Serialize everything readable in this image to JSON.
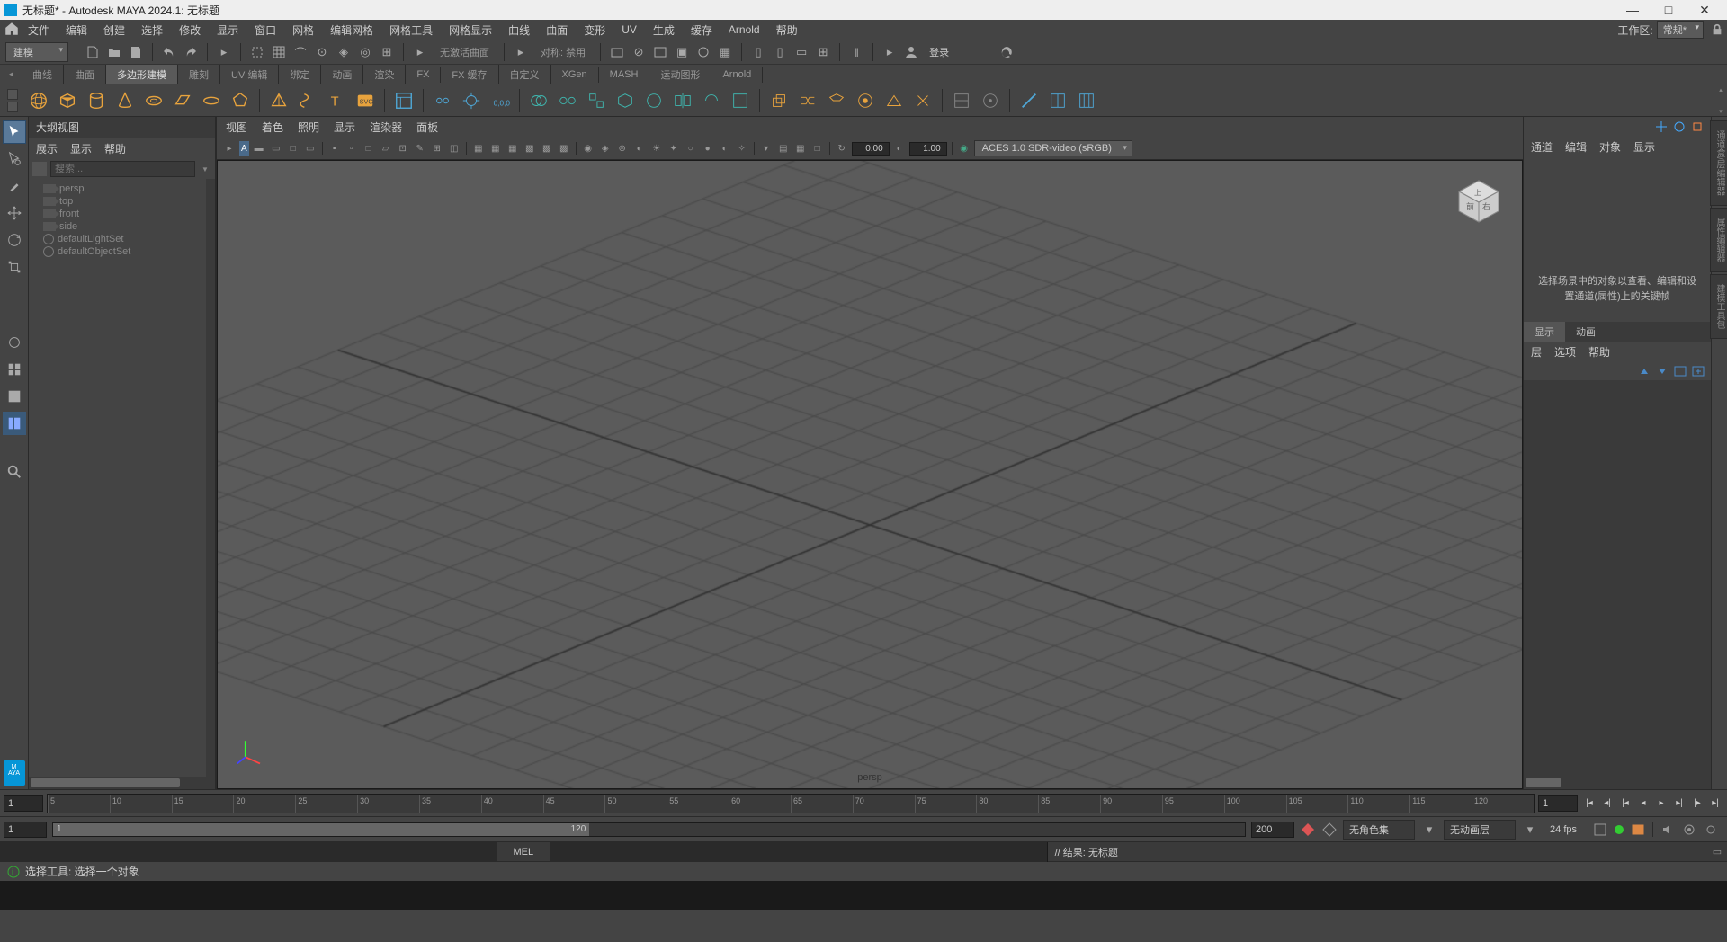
{
  "titlebar": {
    "title": "无标题* - Autodesk MAYA 2024.1: 无标题"
  },
  "menubar": {
    "items": [
      "文件",
      "编辑",
      "创建",
      "选择",
      "修改",
      "显示",
      "窗口",
      "网格",
      "编辑网格",
      "网格工具",
      "网格显示",
      "曲线",
      "曲面",
      "变形",
      "UV",
      "生成",
      "缓存",
      "Arnold",
      "帮助"
    ],
    "workspace_label": "工作区:",
    "workspace_value": "常规*"
  },
  "toolbar1": {
    "mode": "建模",
    "noactive": "无激活曲面",
    "sym_label": "对称: 禁用",
    "login": "登录"
  },
  "tabs": [
    "曲线",
    "曲面",
    "多边形建模",
    "雕刻",
    "UV 编辑",
    "绑定",
    "动画",
    "渲染",
    "FX",
    "FX 缓存",
    "自定义",
    "XGen",
    "MASH",
    "运动图形",
    "Arnold"
  ],
  "active_tab": 2,
  "outliner": {
    "title": "大纲视图",
    "menu": [
      "展示",
      "显示",
      "帮助"
    ],
    "search_placeholder": "搜索...",
    "items": [
      {
        "type": "cam",
        "name": "persp"
      },
      {
        "type": "cam",
        "name": "top"
      },
      {
        "type": "cam",
        "name": "front"
      },
      {
        "type": "cam",
        "name": "side"
      },
      {
        "type": "set",
        "name": "defaultLightSet"
      },
      {
        "type": "set",
        "name": "defaultObjectSet"
      }
    ]
  },
  "viewport": {
    "menu": [
      "视图",
      "着色",
      "照明",
      "显示",
      "渲染器",
      "面板"
    ],
    "val1": "0.00",
    "val2": "1.00",
    "colorspace": "ACES 1.0 SDR-video (sRGB)",
    "camera": "persp"
  },
  "rightpanel": {
    "menu": [
      "通道",
      "编辑",
      "对象",
      "显示"
    ],
    "message": "选择场景中的对象以查看、编辑和设置通道(属性)上的关键帧",
    "tabs": [
      "显示",
      "动画"
    ],
    "active_tab": 0,
    "layermenu": [
      "层",
      "选项",
      "帮助"
    ]
  },
  "righttabs": [
    "通道盒/层编辑器",
    "属性编辑器",
    "建模工具包"
  ],
  "timeline": {
    "current": "1",
    "start": 1,
    "ticks": [
      5,
      10,
      15,
      20,
      25,
      30,
      35,
      40,
      45,
      50,
      55,
      60,
      65,
      70,
      75,
      80,
      85,
      90,
      95,
      100,
      105,
      110,
      115,
      120
    ],
    "end_right": "1"
  },
  "range": {
    "start": "1",
    "range_start": "1",
    "range_end": "120",
    "end": "200",
    "charset": "无角色集",
    "animlayer": "无动画层",
    "fps": "24 fps"
  },
  "cmd": {
    "lang": "MEL",
    "result": "// 结果: 无标题"
  },
  "status": {
    "text": "选择工具: 选择一个对象"
  }
}
